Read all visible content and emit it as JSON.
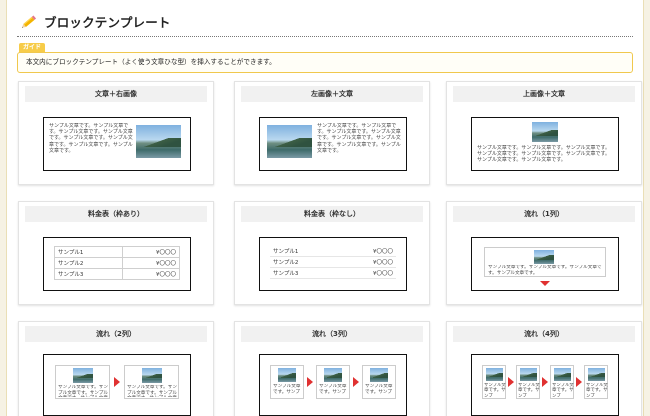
{
  "header": {
    "title": "ブロックテンプレート",
    "icon": "pencil-icon"
  },
  "guide": {
    "tab_label": "ガイド",
    "text": "本文内にブロックテンプレート（よく使う文章ひな型）を挿入することができます。"
  },
  "sample": {
    "text_long": "サンプル文章です。サンプル文章です。サンプル文章です。サンプル文章です。サンプル文章です。サンプル文章です。サンプル文章です。サンプル文章です。",
    "text_short": "サンプル文章です。サンプル文章です。サンプル文章です。サンプル文章です。",
    "text_tiny": "サンプル文章です。サンプ"
  },
  "cards": [
    {
      "title": "文章＋右画像"
    },
    {
      "title": "左画像＋文章"
    },
    {
      "title": "上画像＋文章"
    },
    {
      "title": "料金表（枠あり）"
    },
    {
      "title": "料金表（枠なし）"
    },
    {
      "title": "流れ（1列）"
    },
    {
      "title": "流れ（2列）"
    },
    {
      "title": "流れ（3列）"
    },
    {
      "title": "流れ（4列）"
    }
  ],
  "price_rows": [
    {
      "name": "サンプル1",
      "price": "¥〇〇〇"
    },
    {
      "name": "サンプル2",
      "price": "¥〇〇〇"
    },
    {
      "name": "サンプル3",
      "price": "¥〇〇〇"
    }
  ],
  "colors": {
    "accent": "#f7cc49",
    "arrow": "#e03131"
  }
}
